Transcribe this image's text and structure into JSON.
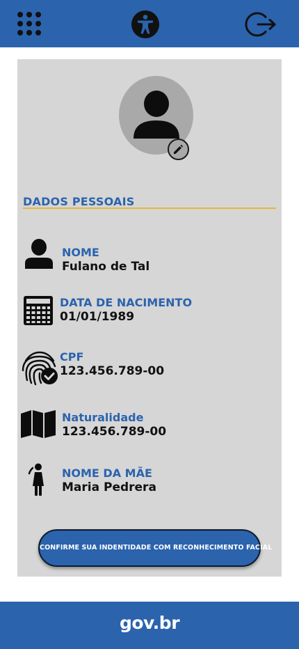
{
  "header": {
    "apps_icon": "grid-icon",
    "accessibility_icon": "accessibility-icon",
    "logout_icon": "logout-icon"
  },
  "profile": {
    "avatar_icon": "person-icon",
    "edit_icon": "pencil-icon"
  },
  "section": {
    "title": "DADOS PESSOAIS"
  },
  "fields": [
    {
      "icon": "person-icon",
      "label": "NOME",
      "value": "Fulano de Tal"
    },
    {
      "icon": "calendar-icon",
      "label": "DATA DE NACIMENTO",
      "value": "01/01/1989"
    },
    {
      "icon": "fingerprint-check-icon",
      "label": "CPF",
      "value": "123.456.789-00"
    },
    {
      "icon": "map-icon",
      "label": "Naturalidade",
      "value": "123.456.789-00"
    },
    {
      "icon": "woman-icon",
      "label": "NOME DA MÃE",
      "value": "Maria Pedrera"
    }
  ],
  "cta": {
    "label": "CONFIRME SUA INDENTIDADE COM RECONHECIMENTO FACIAL"
  },
  "footer": {
    "brand": "gov.br"
  },
  "colors": {
    "primary": "#2b63ad",
    "accent": "#e8b43a",
    "card": "#d6d6d6"
  }
}
